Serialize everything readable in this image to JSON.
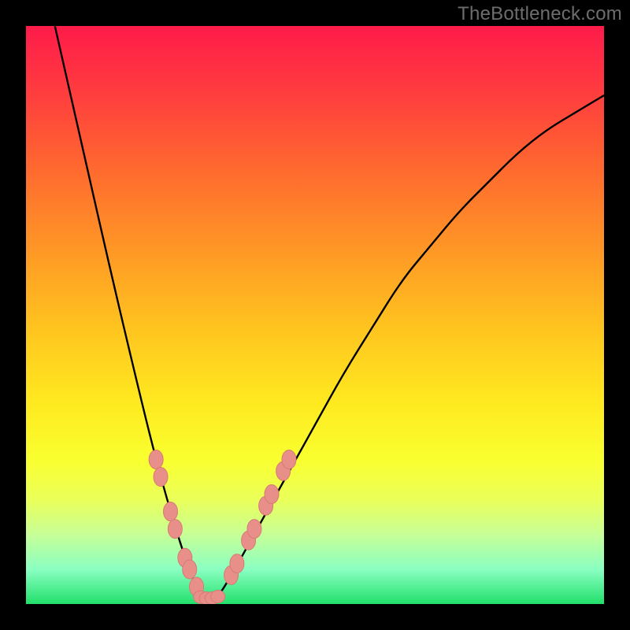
{
  "watermark": "TheBottleneck.com",
  "chart_data": {
    "type": "line",
    "title": "",
    "xlabel": "",
    "ylabel": "",
    "xlim": [
      0,
      1
    ],
    "ylim": [
      0,
      1
    ],
    "legend": false,
    "grid": false,
    "series": [
      {
        "name": "curve",
        "x": [
          0.05,
          0.1,
          0.15,
          0.2,
          0.225,
          0.25,
          0.275,
          0.29,
          0.3,
          0.315,
          0.33,
          0.35,
          0.4,
          0.45,
          0.5,
          0.55,
          0.6,
          0.65,
          0.7,
          0.75,
          0.8,
          0.85,
          0.9,
          0.95,
          1.0
        ],
        "y": [
          1.0,
          0.78,
          0.56,
          0.35,
          0.25,
          0.16,
          0.08,
          0.04,
          0.02,
          0.01,
          0.01,
          0.04,
          0.13,
          0.22,
          0.31,
          0.4,
          0.48,
          0.56,
          0.62,
          0.68,
          0.73,
          0.78,
          0.82,
          0.85,
          0.88
        ]
      }
    ],
    "markers_left": [
      {
        "x": 0.225,
        "y": 0.25
      },
      {
        "x": 0.233,
        "y": 0.22
      },
      {
        "x": 0.25,
        "y": 0.16
      },
      {
        "x": 0.258,
        "y": 0.13
      },
      {
        "x": 0.275,
        "y": 0.08
      },
      {
        "x": 0.283,
        "y": 0.06
      },
      {
        "x": 0.295,
        "y": 0.03
      }
    ],
    "markers_bottom": [
      {
        "x": 0.302,
        "y": 0.012
      },
      {
        "x": 0.312,
        "y": 0.01
      },
      {
        "x": 0.322,
        "y": 0.01
      },
      {
        "x": 0.332,
        "y": 0.013
      }
    ],
    "markers_right": [
      {
        "x": 0.355,
        "y": 0.05
      },
      {
        "x": 0.365,
        "y": 0.07
      },
      {
        "x": 0.385,
        "y": 0.11
      },
      {
        "x": 0.395,
        "y": 0.13
      },
      {
        "x": 0.415,
        "y": 0.17
      },
      {
        "x": 0.425,
        "y": 0.19
      },
      {
        "x": 0.445,
        "y": 0.23
      },
      {
        "x": 0.455,
        "y": 0.25
      }
    ],
    "background_gradient_stops": [
      {
        "pos": 0.0,
        "color": "#ff1b4a"
      },
      {
        "pos": 0.25,
        "color": "#ff6a2f"
      },
      {
        "pos": 0.55,
        "color": "#ffe01f"
      },
      {
        "pos": 0.8,
        "color": "#eaff5a"
      },
      {
        "pos": 1.0,
        "color": "#22e06b"
      }
    ]
  }
}
